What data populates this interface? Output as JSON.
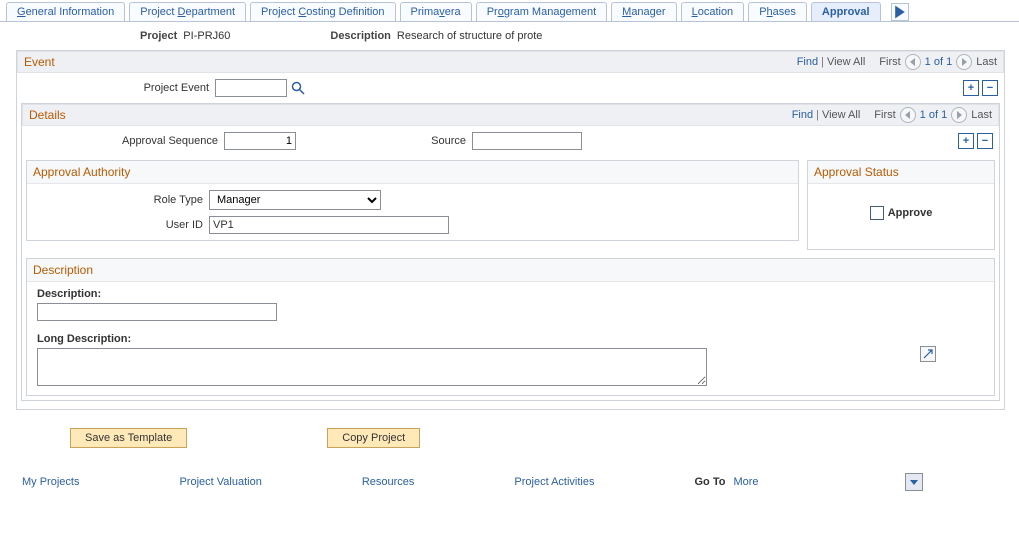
{
  "tabs": {
    "items": [
      {
        "pre": "",
        "u": "G",
        "post": "eneral Information"
      },
      {
        "pre": "Project ",
        "u": "D",
        "post": "epartment"
      },
      {
        "pre": "Project ",
        "u": "C",
        "post": "osting Definition"
      },
      {
        "pre": "Prima",
        "u": "v",
        "post": "era"
      },
      {
        "pre": "Pr",
        "u": "o",
        "post": "gram Management"
      },
      {
        "pre": "",
        "u": "M",
        "post": "anager"
      },
      {
        "pre": "",
        "u": "L",
        "post": "ocation"
      },
      {
        "pre": "P",
        "u": "h",
        "post": "ases"
      },
      {
        "pre": "Approval",
        "u": "",
        "post": ""
      }
    ],
    "active_index": 8
  },
  "header": {
    "project_label": "Project",
    "project_value": "PI-PRJ60",
    "description_label": "Description",
    "description_value": "Research of structure of prote"
  },
  "event_panel": {
    "title": "Event",
    "find": "Find",
    "view_all": "View All",
    "first": "First",
    "pager": "1 of 1",
    "last": "Last",
    "project_event_label": "Project Event",
    "project_event_value": ""
  },
  "details_panel": {
    "title": "Details",
    "find": "Find",
    "view_all": "View All",
    "first": "First",
    "pager": "1 of 1",
    "last": "Last",
    "approval_sequence_label": "Approval Sequence",
    "approval_sequence_value": "1",
    "source_label": "Source",
    "source_value": ""
  },
  "approval_authority": {
    "title": "Approval Authority",
    "role_type_label": "Role Type",
    "role_type_value": "Manager",
    "user_id_label": "User ID",
    "user_id_value": "VP1"
  },
  "approval_status": {
    "title": "Approval Status",
    "approve_label": "Approve",
    "approve_checked": false
  },
  "description_box": {
    "title": "Description",
    "desc_label": "Description:",
    "desc_value": "",
    "long_desc_label": "Long Description:",
    "long_desc_value": ""
  },
  "buttons": {
    "save_template": "Save as Template",
    "copy_project": "Copy Project"
  },
  "footer": {
    "links": [
      "My Projects",
      "Project Valuation",
      "Resources",
      "Project Activities"
    ],
    "goto_label": "Go To",
    "goto_value": "More"
  }
}
